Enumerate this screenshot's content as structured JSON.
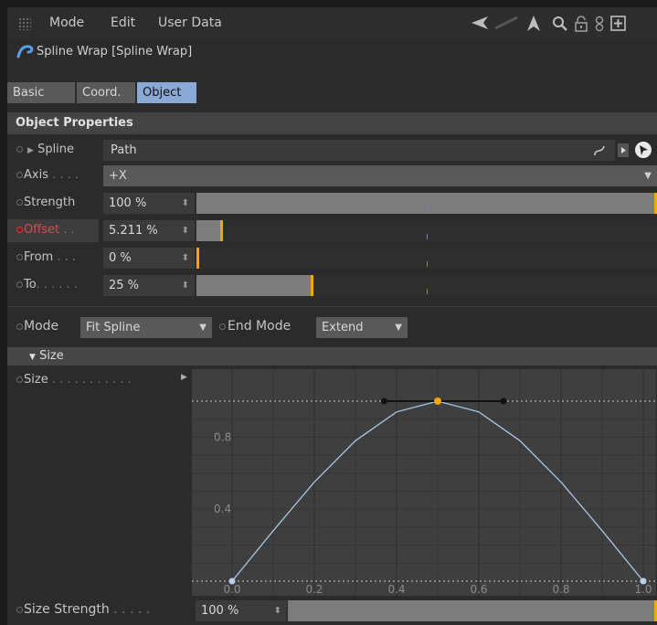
{
  "menubar": {
    "items": [
      "Mode",
      "Edit",
      "User Data"
    ]
  },
  "object_title": "Spline Wrap [Spline Wrap]",
  "tabs": [
    {
      "label": "Basic",
      "active": false
    },
    {
      "label": "Coord.",
      "active": false
    },
    {
      "label": "Object",
      "active": true
    }
  ],
  "section_title": "Object Properties",
  "spline": {
    "label": "Spline",
    "value": "Path"
  },
  "axis": {
    "label": "Axis",
    "value": "+X"
  },
  "strength": {
    "label": "Strength",
    "value": "100 %",
    "fraction": 1.0
  },
  "offset": {
    "label": "Offset",
    "value": "5.211 %",
    "fraction": 0.05211,
    "animated": true
  },
  "from": {
    "label": "From",
    "value": "0 %",
    "fraction": 0.0
  },
  "to": {
    "label": "To",
    "value": "25 %",
    "fraction": 0.25
  },
  "mode": {
    "label": "Mode",
    "value": "Fit Spline"
  },
  "end_mode": {
    "label": "End Mode",
    "value": "Extend"
  },
  "size_group": "Size",
  "size_label": "Size",
  "size_strength": {
    "label": "Size Strength",
    "value": "100 %",
    "fraction": 1.0
  },
  "colors": {
    "accent": "#f0a700",
    "active_tab": "#8aa9d6",
    "curve": "#a9c6e8"
  },
  "chart_data": {
    "type": "line",
    "x_ticks": [
      "0.0",
      "0.2",
      "0.4",
      "0.6",
      "0.8",
      "1.0"
    ],
    "y_ticks": [
      "0.8",
      "0.4"
    ],
    "xlim": [
      0,
      1
    ],
    "ylim": [
      0,
      1
    ],
    "curve_points": [
      {
        "x": 0.0,
        "y": 0.0
      },
      {
        "x": 0.1,
        "y": 0.28
      },
      {
        "x": 0.2,
        "y": 0.55
      },
      {
        "x": 0.3,
        "y": 0.78
      },
      {
        "x": 0.4,
        "y": 0.94
      },
      {
        "x": 0.5,
        "y": 1.0
      },
      {
        "x": 0.6,
        "y": 0.94
      },
      {
        "x": 0.7,
        "y": 0.78
      },
      {
        "x": 0.8,
        "y": 0.55
      },
      {
        "x": 0.9,
        "y": 0.28
      },
      {
        "x": 1.0,
        "y": 0.0
      }
    ],
    "knots": [
      {
        "x": 0.0,
        "y": 0.0
      },
      {
        "x": 0.5,
        "y": 1.0
      },
      {
        "x": 1.0,
        "y": 0.0
      }
    ],
    "tangent_handles": [
      {
        "x": 0.37,
        "y": 1.0
      },
      {
        "x": 0.66,
        "y": 1.0
      }
    ],
    "grid": true
  }
}
